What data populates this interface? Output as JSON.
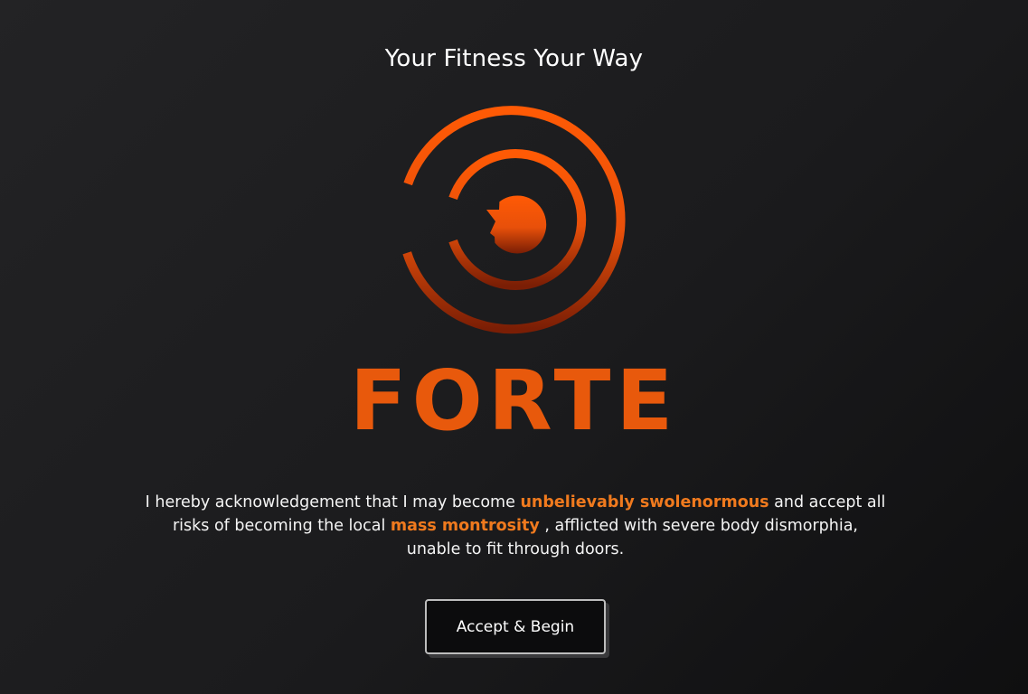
{
  "header": {
    "tagline": "Your Fitness Your Way"
  },
  "logo": {
    "icon": "forte-target-logo-icon",
    "brand_name": "FORTE",
    "colors": {
      "top": "#ff5a05",
      "bottom": "#7a1e05",
      "wordmark": "#e8590c"
    }
  },
  "disclaimer": {
    "part1": "I hereby acknowledgement that I may become ",
    "highlight1": "unbelievably swolenormous",
    "part2": " and accept all risks of becoming the local ",
    "highlight2": "mass montrosity",
    "part3": " , afflicted with severe body dismorphia, unable to fit through doors.",
    "highlight_color": "#f07a1e"
  },
  "actions": {
    "accept_label": "Accept & Begin"
  }
}
